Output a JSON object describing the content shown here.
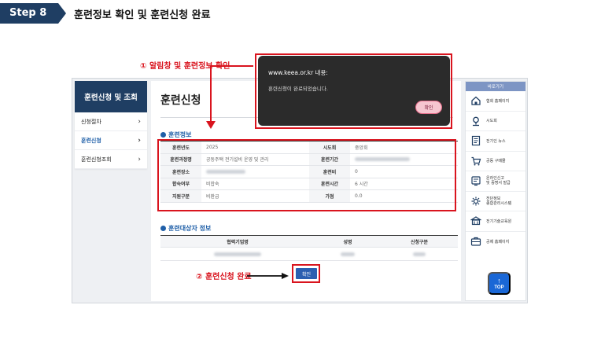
{
  "step": {
    "label": "Step 8",
    "title": "훈련정보 확인 및 훈련신청 완료"
  },
  "annotations": {
    "one": "① 알림창 및 훈련정보 확인",
    "two": "② 훈련신청 완료"
  },
  "sidebar": {
    "title": "훈련신청 및 조회",
    "items": [
      {
        "label": "신청절차"
      },
      {
        "label": "훈련신청"
      },
      {
        "label": "훈련신청조회"
      }
    ]
  },
  "main": {
    "title": "훈련신청",
    "training_info": {
      "section_title": "훈련정보",
      "rows": [
        {
          "label1": "훈련년도",
          "value1": "2025",
          "label2": "시도회",
          "value2": "중앙회"
        },
        {
          "label1": "훈련과정명",
          "value1": "공동주택 전기설비 운영 및 관리",
          "label2": "훈련기간",
          "value2": ""
        },
        {
          "label1": "훈련장소",
          "value1": "",
          "label2": "훈련비",
          "value2": "0"
        },
        {
          "label1": "합숙여부",
          "value1": "비합숙",
          "label2": "훈련시간",
          "value2": "6 시간"
        },
        {
          "label1": "지원구분",
          "value1": "비환급",
          "label2": "가점",
          "value2": "0.0"
        }
      ]
    },
    "target_info": {
      "section_title": "훈련대상자 정보",
      "headers": [
        "협력기업명",
        "성명",
        "신청구분"
      ]
    },
    "confirm_label": "확인"
  },
  "quick_menu": {
    "title": "바로가기",
    "items": [
      {
        "label": "협회 홈페이지",
        "icon": "home-icon"
      },
      {
        "label": "시도회",
        "icon": "location-icon"
      },
      {
        "label": "전기인 뉴스",
        "icon": "news-icon"
      },
      {
        "label": "공동 구매몰",
        "icon": "shop-icon"
      },
      {
        "label": "온라인신고\n및 증명서 발급",
        "icon": "certificate-icon"
      },
      {
        "label": "전단정보\n종합관리시스템",
        "icon": "system-icon"
      },
      {
        "label": "전기기술교육원",
        "icon": "school-icon"
      },
      {
        "label": "공제 홈페이지",
        "icon": "mutual-aid-icon"
      }
    ],
    "top_label": "TOP"
  },
  "alert": {
    "origin": "www.keea.or.kr 내용:",
    "message": "훈련신청이 완료되었습니다.",
    "ok_label": "확인"
  },
  "colors": {
    "navy": "#1f3e63",
    "primary_blue": "#1f5fa8",
    "highlight_red": "#d9141e"
  }
}
